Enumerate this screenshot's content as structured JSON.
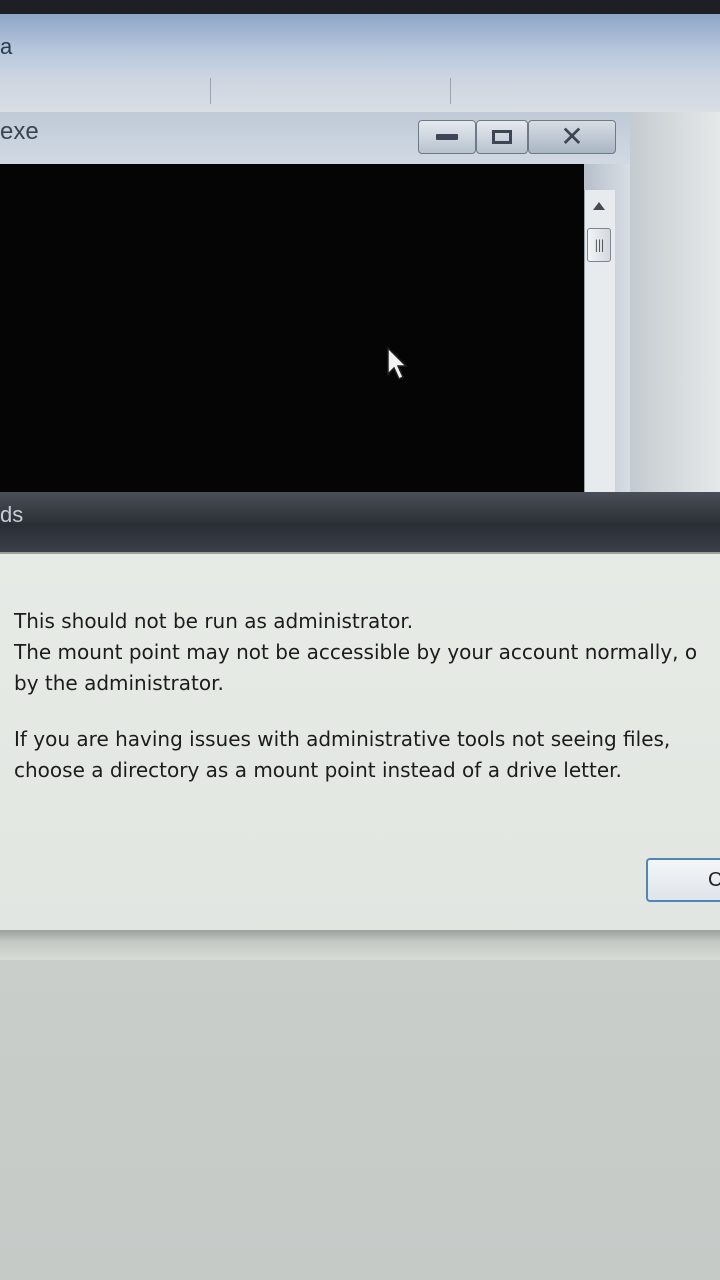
{
  "background_window": {
    "title_fragment": "a"
  },
  "console_window": {
    "title_fragment": "exe",
    "minimize_icon": "minimize-icon",
    "maximize_icon": "maximize-icon",
    "close_icon": "close-icon"
  },
  "dialog": {
    "title_fragment": "ds",
    "message_lines": [
      "This should not be run as administrator.",
      "The mount point may not be accessible by your account normally, o",
      "by the administrator."
    ],
    "message_lines_2": [
      "If you are having issues with administrative tools not seeing files,",
      "choose a directory as a mount point instead of a drive letter."
    ],
    "button_label": "C"
  }
}
